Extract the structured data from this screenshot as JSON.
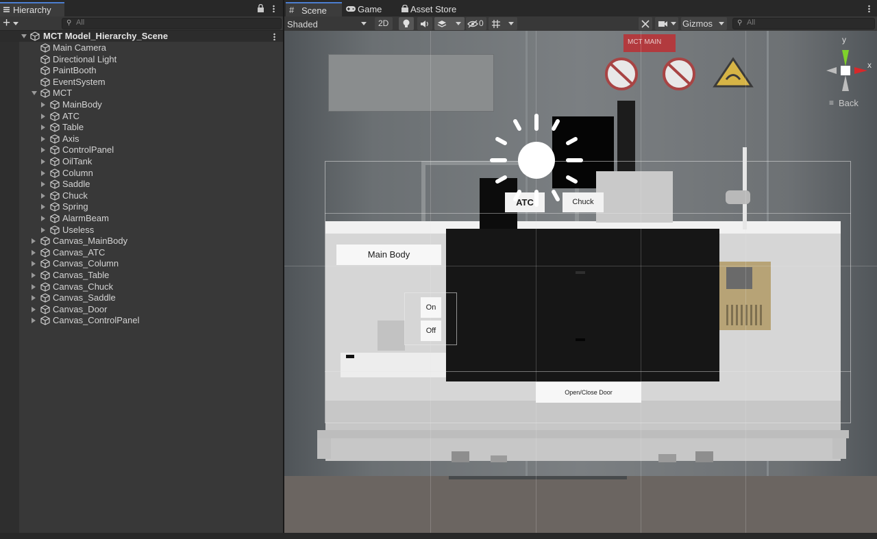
{
  "hierarchy": {
    "tab_label": "Hierarchy",
    "search_placeholder": "All",
    "scene_name": "MCT Model_Hierarchy_Scene",
    "items": [
      {
        "label": "Main Camera",
        "depth": 1,
        "fold": "none"
      },
      {
        "label": "Directional Light",
        "depth": 1,
        "fold": "none"
      },
      {
        "label": "PaintBooth",
        "depth": 1,
        "fold": "none"
      },
      {
        "label": "EventSystem",
        "depth": 1,
        "fold": "none"
      },
      {
        "label": "MCT",
        "depth": 1,
        "fold": "open"
      },
      {
        "label": "MainBody",
        "depth": 2,
        "fold": "closed"
      },
      {
        "label": "ATC",
        "depth": 2,
        "fold": "closed"
      },
      {
        "label": "Table",
        "depth": 2,
        "fold": "closed"
      },
      {
        "label": "Axis",
        "depth": 2,
        "fold": "closed"
      },
      {
        "label": "ControlPanel",
        "depth": 2,
        "fold": "closed"
      },
      {
        "label": "OilTank",
        "depth": 2,
        "fold": "closed"
      },
      {
        "label": "Column",
        "depth": 2,
        "fold": "closed"
      },
      {
        "label": "Saddle",
        "depth": 2,
        "fold": "closed"
      },
      {
        "label": "Chuck",
        "depth": 2,
        "fold": "closed"
      },
      {
        "label": "Spring",
        "depth": 2,
        "fold": "closed"
      },
      {
        "label": "AlarmBeam",
        "depth": 2,
        "fold": "closed"
      },
      {
        "label": "Useless",
        "depth": 2,
        "fold": "closed"
      },
      {
        "label": "Canvas_MainBody",
        "depth": 1,
        "fold": "closed"
      },
      {
        "label": "Canvas_ATC",
        "depth": 1,
        "fold": "closed"
      },
      {
        "label": "Canvas_Column",
        "depth": 1,
        "fold": "closed"
      },
      {
        "label": "Canvas_Table",
        "depth": 1,
        "fold": "closed"
      },
      {
        "label": "Canvas_Chuck",
        "depth": 1,
        "fold": "closed"
      },
      {
        "label": "Canvas_Saddle",
        "depth": 1,
        "fold": "closed"
      },
      {
        "label": "Canvas_Door",
        "depth": 1,
        "fold": "closed"
      },
      {
        "label": "Canvas_ControlPanel",
        "depth": 1,
        "fold": "closed"
      }
    ]
  },
  "scene_tabs": [
    {
      "label": "Scene",
      "icon": "hash-icon",
      "active": true
    },
    {
      "label": "Game",
      "icon": "gamepad-icon",
      "active": false
    },
    {
      "label": "Asset Store",
      "icon": "store-icon",
      "active": false
    }
  ],
  "scene_toolbar": {
    "shading_mode": "Shaded",
    "mode_2d": "2D",
    "hidden_count": "0",
    "gizmos_label": "Gizmos",
    "search_placeholder": "All"
  },
  "viewport": {
    "buttons": {
      "main_body": "Main Body",
      "atc": "ATC",
      "chuck": "Chuck",
      "on": "On",
      "off": "Off",
      "open_close_door": "Open/Close Door"
    },
    "sign_text": "MCT MAIN",
    "axis_gizmo": {
      "y": "y",
      "x": "x",
      "back": "Back"
    }
  },
  "colors": {
    "accent": "#4c7fd1",
    "gizmo_x": "#d8282a",
    "gizmo_y": "#7fd12b"
  }
}
